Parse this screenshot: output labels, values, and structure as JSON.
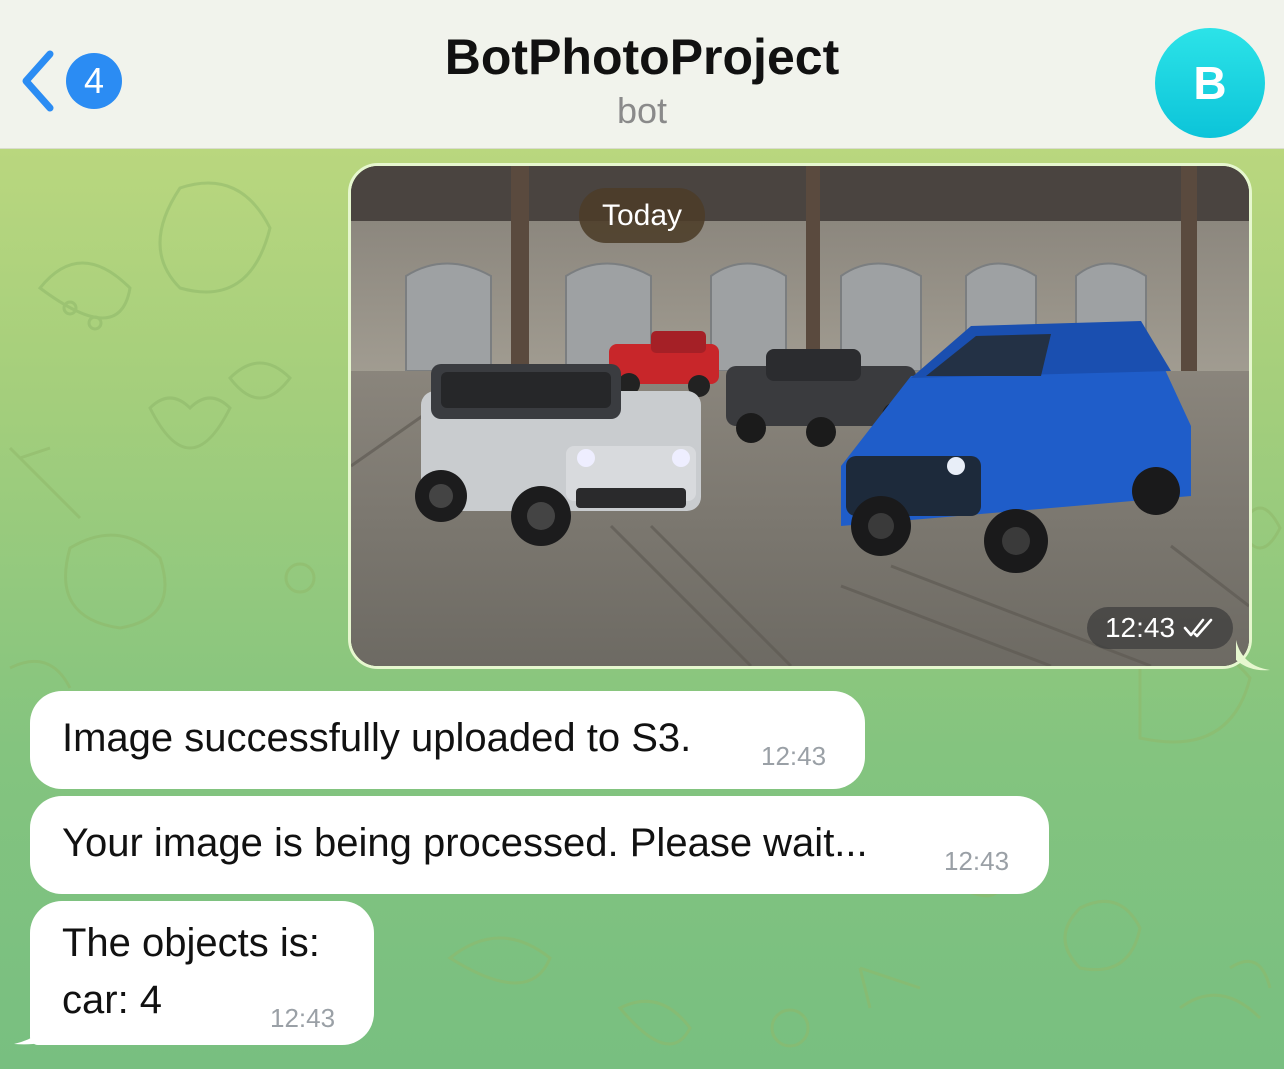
{
  "header": {
    "back_badge": "4",
    "title": "BotPhotoProject",
    "subtitle": "bot",
    "avatar_letter": "B"
  },
  "date_separator": "Today",
  "photo_message": {
    "time": "12:43",
    "status": "read"
  },
  "messages": [
    {
      "text": "Image successfully uploaded to S3.",
      "time": "12:43"
    },
    {
      "text": "Your image is being processed. Please wait...",
      "time": "12:43"
    },
    {
      "lines": [
        "The objects is:",
        "car: 4"
      ],
      "time": "12:43"
    }
  ],
  "colors": {
    "header_bg": "#f1f3ec",
    "accent_blue": "#2b8cf3",
    "avatar": "#12cade",
    "outgoing_border": "#e6f7cf",
    "wallpaper_top": "#c6dc80",
    "wallpaper_bottom": "#78bf80"
  }
}
